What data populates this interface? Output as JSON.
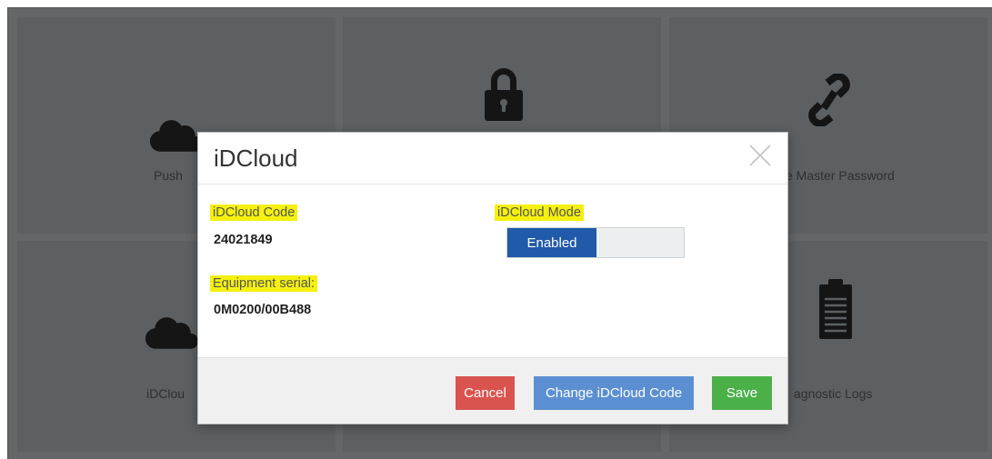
{
  "background": {
    "tiles": [
      {
        "label": "Push",
        "icon": "cloud-icon"
      },
      {
        "label": "",
        "icon": "lock-icon"
      },
      {
        "label": "e Master Password",
        "icon": "link-icon"
      },
      {
        "label": "iDClou",
        "icon": "cloud-icon"
      },
      {
        "label": "",
        "icon": ""
      },
      {
        "label": "agnostic Logs",
        "icon": "clipboard-icon"
      }
    ]
  },
  "modal": {
    "title": "iDCloud",
    "code_label": "iDCloud Code",
    "code_value": "24021849",
    "serial_label": "Equipment serial:",
    "serial_value": "0M0200/00B488",
    "mode_label": "iDCloud Mode",
    "mode_toggle": "Enabled",
    "cancel": "Cancel",
    "change_code": "Change iDCloud Code",
    "save": "Save"
  },
  "colors": {
    "highlight": "#f4f00f",
    "toggle_on": "#215aa8",
    "cancel": "#d9534f",
    "change": "#5b8fd1",
    "save": "#4cb049",
    "overlay": "#646668"
  }
}
